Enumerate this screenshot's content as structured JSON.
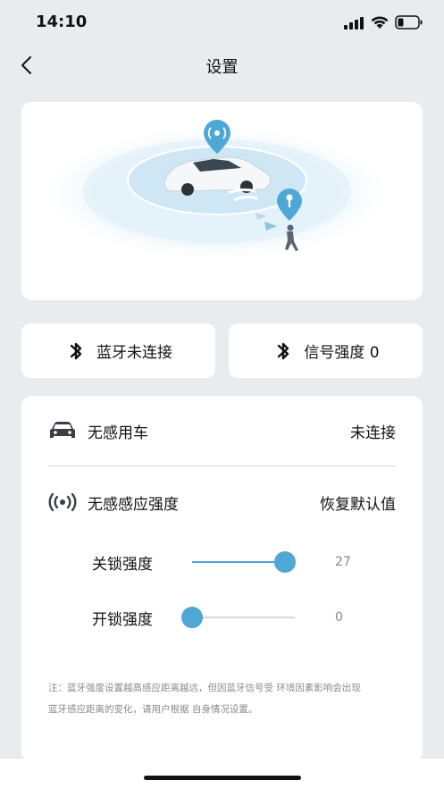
{
  "status_bar": {
    "time": "14:10"
  },
  "header": {
    "title": "设置"
  },
  "hero": {
    "image_alt": "car-and-key-proximity-illustration"
  },
  "bluetooth_card": {
    "label": "蓝牙未连接"
  },
  "signal_card": {
    "label": "信号强度 0"
  },
  "settings": {
    "unlock_free": {
      "label": "无感用车",
      "value": "未连接"
    },
    "sensing_strength": {
      "label": "无感感应强度",
      "action": "恢复默认值"
    },
    "lock_strength": {
      "label": "关锁强度",
      "value": "27",
      "fraction": 0.9
    },
    "unlock_strength": {
      "label": "开锁强度",
      "value": "0",
      "fraction": 0.0
    },
    "note_line1": "注：蓝牙强度设置越高感应距离越远，但因蓝牙信号受 环境因素影响会出现",
    "note_line2": "蓝牙感应距离的变化，请用户根据 自身情况设置。"
  },
  "colors": {
    "accent": "#4ea7d4",
    "background": "#e9ecef"
  }
}
